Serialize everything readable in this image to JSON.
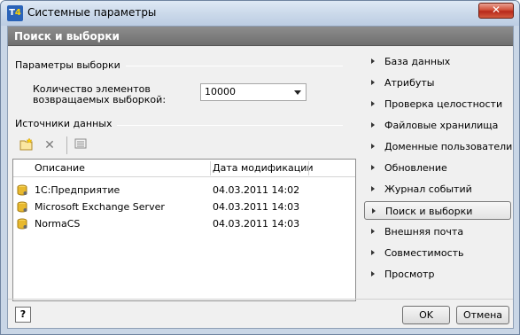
{
  "window": {
    "title": "Системные параметры",
    "app_icon_text": "T",
    "app_icon_accent": "4",
    "close_label": "✕"
  },
  "header": {
    "title": "Поиск и выборки"
  },
  "selection_params": {
    "group_title": "Параметры выборки",
    "count_label_line1": "Количество элементов",
    "count_label_line2": "возвращаемых выборкой:",
    "count_value": "10000"
  },
  "data_sources": {
    "group_title": "Источники данных",
    "toolbar": [
      {
        "icon": "new-folder-icon"
      },
      {
        "icon": "delete-icon",
        "glyph": "✕"
      },
      {
        "icon": "properties-icon"
      }
    ],
    "columns": [
      "Описание",
      "Дата модификации"
    ],
    "rows": [
      {
        "name": "1С:Предприятие",
        "date": "04.03.2011 14:02"
      },
      {
        "name": "Microsoft Exchange Server",
        "date": "04.03.2011 14:03"
      },
      {
        "name": "NormaCS",
        "date": "04.03.2011 14:03"
      }
    ]
  },
  "nav": {
    "items": [
      {
        "label": "База данных"
      },
      {
        "label": "Атрибуты"
      },
      {
        "label": "Проверка целостности"
      },
      {
        "label": "Файловые хранилища"
      },
      {
        "label": "Доменные пользователи"
      },
      {
        "label": "Обновление"
      },
      {
        "label": "Журнал событий"
      },
      {
        "label": "Поиск и выборки",
        "active": true
      },
      {
        "label": "Внешняя почта"
      },
      {
        "label": "Совместимость"
      },
      {
        "label": "Просмотр"
      }
    ]
  },
  "footer": {
    "help_label": "?",
    "ok_label": "OK",
    "cancel_label": "Отмена"
  },
  "colors": {
    "header_band": "#7c7c7c",
    "close_button": "#c8412c",
    "app_icon": "#2a63b8"
  }
}
